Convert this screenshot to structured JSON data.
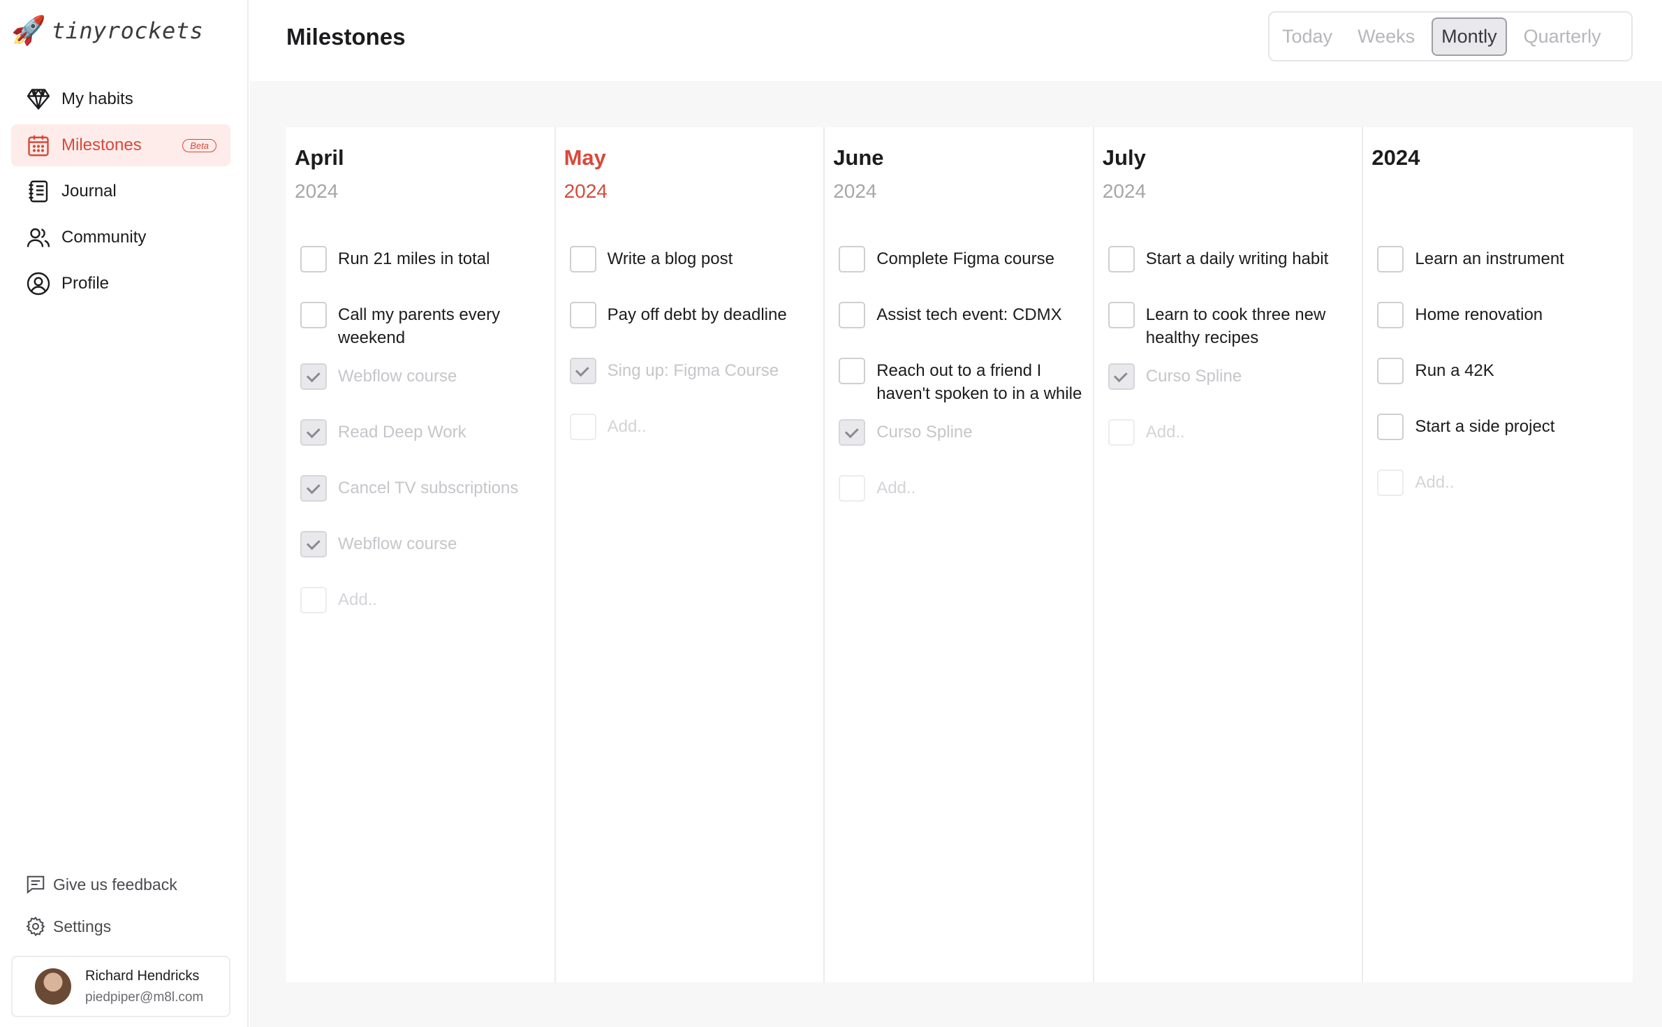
{
  "app": {
    "brand": "tinyrockets",
    "page_title": "Milestones"
  },
  "sidebar": {
    "items": [
      {
        "label": "My habits",
        "icon": "diamond-icon",
        "active": false
      },
      {
        "label": "Milestones",
        "icon": "calendar-icon",
        "active": true,
        "badge": "Beta"
      },
      {
        "label": "Journal",
        "icon": "notebook-icon",
        "active": false
      },
      {
        "label": "Community",
        "icon": "users-icon",
        "active": false
      },
      {
        "label": "Profile",
        "icon": "user-circle-icon",
        "active": false
      }
    ],
    "bottom": [
      {
        "label": "Give us feedback",
        "icon": "message-icon"
      },
      {
        "label": "Settings",
        "icon": "gear-icon"
      }
    ],
    "user": {
      "name": "Richard Hendricks",
      "email": "piedpiper@m8l.com"
    }
  },
  "view_switch": {
    "options": [
      "Today",
      "Weeks",
      "Montly",
      "Quarterly"
    ],
    "selected": "Montly"
  },
  "columns": [
    {
      "month": "April",
      "year": "2024",
      "current": false,
      "tasks": [
        {
          "label": "Run 21 miles in total",
          "done": false
        },
        {
          "label": "Call my parents every weekend",
          "done": false
        },
        {
          "label": "Webflow course",
          "done": true
        },
        {
          "label": "Read Deep Work",
          "done": true
        },
        {
          "label": "Cancel TV subscriptions",
          "done": true
        },
        {
          "label": "Webflow course",
          "done": true
        }
      ],
      "add_placeholder": "Add.."
    },
    {
      "month": "May",
      "year": "2024",
      "current": true,
      "tasks": [
        {
          "label": "Write a blog post",
          "done": false
        },
        {
          "label": "Pay off debt by deadline",
          "done": false
        },
        {
          "label": "Sing up: Figma Course",
          "done": true
        }
      ],
      "add_placeholder": "Add.."
    },
    {
      "month": "June",
      "year": "2024",
      "current": false,
      "tasks": [
        {
          "label": "Complete Figma course",
          "done": false
        },
        {
          "label": "Assist tech event: CDMX",
          "done": false
        },
        {
          "label": "Reach out to a friend I haven't spoken to in a while",
          "done": false
        },
        {
          "label": "Curso Spline",
          "done": true
        }
      ],
      "add_placeholder": "Add.."
    },
    {
      "month": "July",
      "year": "2024",
      "current": false,
      "tasks": [
        {
          "label": "Start a daily writing habit",
          "done": false
        },
        {
          "label": "Learn to cook three new healthy recipes",
          "done": false
        },
        {
          "label": "Curso Spline",
          "done": true
        }
      ],
      "add_placeholder": "Add.."
    },
    {
      "month": "2024",
      "year": "",
      "current": false,
      "tasks": [
        {
          "label": "Learn an instrument",
          "done": false
        },
        {
          "label": "Home renovation",
          "done": false
        },
        {
          "label": "Run a 42K",
          "done": false
        },
        {
          "label": "Start a side project",
          "done": false
        }
      ],
      "add_placeholder": "Add.."
    }
  ],
  "colors": {
    "accent": "#d8493a",
    "accent_bg": "#fdecea",
    "muted": "#a6a6ab",
    "board_bg": "#f7f7f8"
  }
}
